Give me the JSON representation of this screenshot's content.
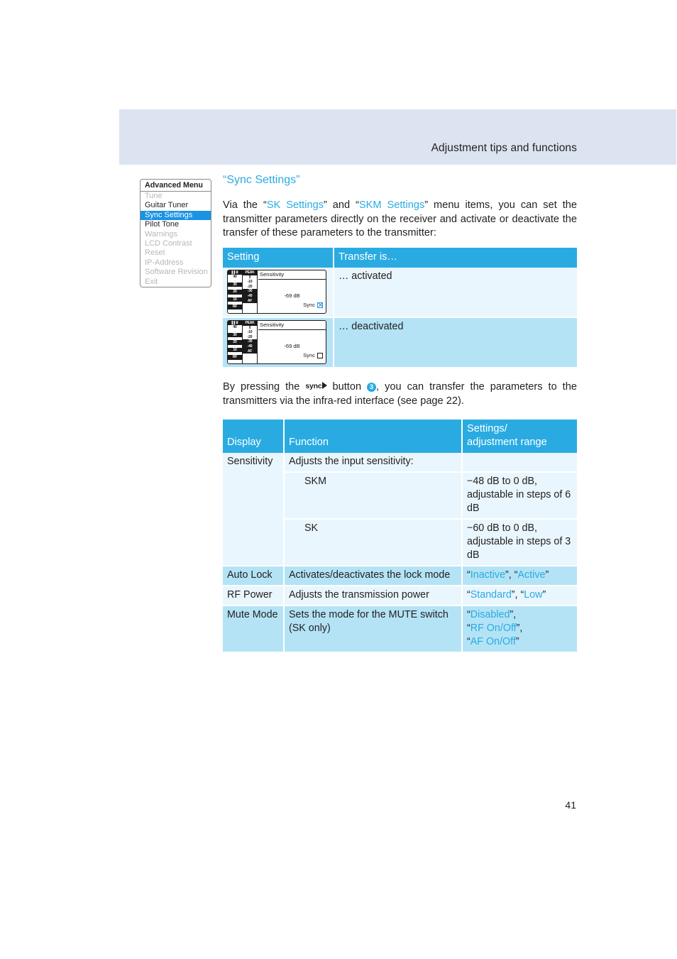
{
  "header": {
    "title": "Adjustment tips and functions"
  },
  "page_number": "41",
  "menu": {
    "title": "Advanced Menu",
    "items": [
      {
        "label": "Tune",
        "state": "dim"
      },
      {
        "label": "Guitar Tuner",
        "state": "on"
      },
      {
        "label": "Sync Settings",
        "state": "selected"
      },
      {
        "label": "Pilot Tone",
        "state": "on"
      },
      {
        "label": "Warnings",
        "state": "dim"
      },
      {
        "label": "LCD Contrast",
        "state": "dim"
      },
      {
        "label": "Reset",
        "state": "dim"
      },
      {
        "label": "IP-Address",
        "state": "dim"
      },
      {
        "label": "Software Revision",
        "state": "dim"
      },
      {
        "label": "Exit",
        "state": "dim"
      }
    ]
  },
  "section": {
    "heading": "“Sync Settings”",
    "intro": {
      "t1": "Via the “",
      "link1": "SK Settings",
      "t2": "” and “",
      "link2": "SKM Settings",
      "t3": "” menu items, you can set the transmitter parameters directly on the receiver and activate or deactivate the transfer of these parameters to the transmitter:"
    },
    "sync_para": {
      "t1": "By pressing the",
      "glyph_label": "sync",
      "t2": "button",
      "badge": "3",
      "t3": ", you can transfer the parameters to the transmitters via the infra-red interface (see page 22)."
    }
  },
  "table_setting": {
    "headers": [
      "Setting",
      "Transfer is…"
    ],
    "rows": [
      {
        "transfer": "… activated",
        "sync_checked": true
      },
      {
        "transfer": "… deactivated",
        "sync_checked": false
      }
    ]
  },
  "lcd": {
    "rf_scale": [
      "40",
      "·",
      "30",
      "·",
      "20",
      "·",
      "10",
      "·",
      "RF"
    ],
    "af_scale": [
      "PEAK",
      "0",
      "-10",
      "-20",
      "-30",
      "-40",
      "AF"
    ],
    "field_label": "Sensitivity",
    "value": "-69 dB",
    "sync_label": "Sync"
  },
  "table_params": {
    "headers": [
      "Display",
      "Function",
      "Settings/\nadjustment range"
    ],
    "header_settings_line1": "Settings/",
    "header_settings_line2": "adjustment range",
    "rows": [
      {
        "display": "Sensitivity",
        "function": "Adjusts the input sensitivity:",
        "range": "",
        "shade": "A"
      },
      {
        "display": "",
        "function": "SKM",
        "indent": true,
        "range": "−48 dB to 0 dB, adjustable in steps of 6 dB",
        "shade": "A"
      },
      {
        "display": "",
        "function": "SK",
        "indent": true,
        "range": "−60 dB to 0 dB, adjustable in steps of 3 dB",
        "shade": "A"
      },
      {
        "display": "Auto Lock",
        "function": "Activates/deactivates the lock mode",
        "range_parts": [
          "“",
          "Inactive",
          "”, “",
          "Active",
          "”"
        ],
        "shade": "B"
      },
      {
        "display": "RF Power",
        "function": "Adjusts the transmission power",
        "range_parts": [
          "“",
          "Standard",
          "”, “",
          "Low",
          "”"
        ],
        "shade": "A"
      },
      {
        "display": "Mute Mode",
        "function": "Sets the mode for the MUTE switch (SK only)",
        "range_parts": [
          "“",
          "Disabled",
          "”,",
          "RF On/Off",
          "AF On/Off"
        ],
        "shade": "B"
      }
    ]
  },
  "colors": {
    "accent": "#29abe2",
    "header_band": "#dce4f2",
    "row_light": "#e9f6fd",
    "row_medium": "#b4e3f6",
    "menu_highlight": "#1a93e3"
  }
}
